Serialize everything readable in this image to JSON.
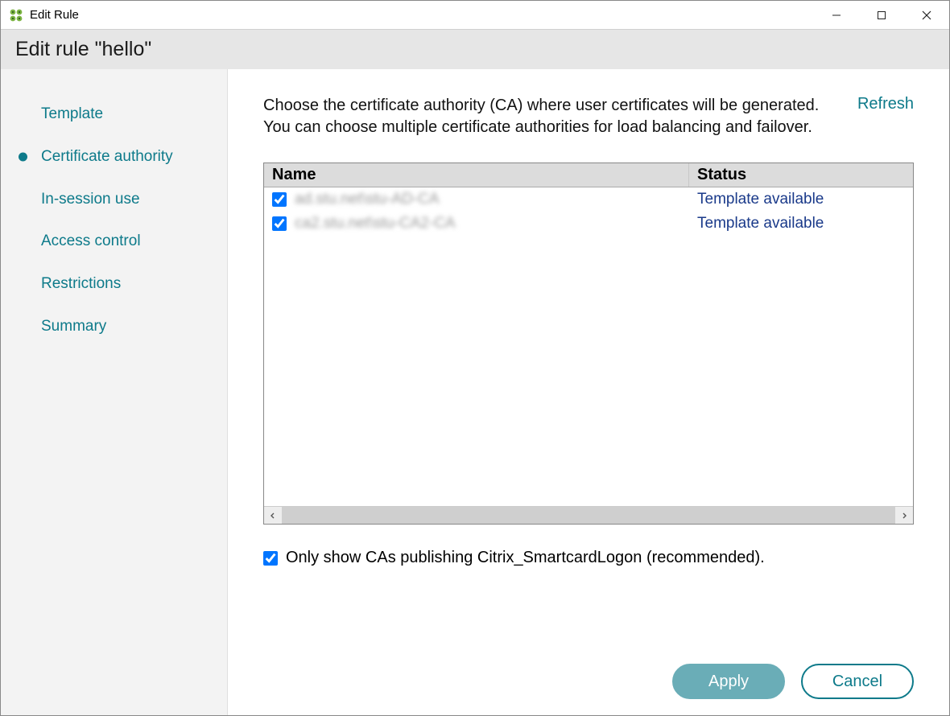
{
  "window": {
    "title": "Edit Rule"
  },
  "header": {
    "title": "Edit rule \"hello\""
  },
  "sidebar": {
    "items": [
      {
        "label": "Template",
        "active": false
      },
      {
        "label": "Certificate authority",
        "active": true
      },
      {
        "label": "In-session use",
        "active": false
      },
      {
        "label": "Access control",
        "active": false
      },
      {
        "label": "Restrictions",
        "active": false
      },
      {
        "label": "Summary",
        "active": false
      }
    ]
  },
  "content": {
    "description": "Choose the certificate authority (CA) where user certificates will be generated. You can choose multiple certificate authorities for load balancing and failover.",
    "refresh_label": "Refresh",
    "table": {
      "columns": {
        "name": "Name",
        "status": "Status"
      },
      "rows": [
        {
          "checked": true,
          "name": "ad.stu.net\\stu-AD-CA",
          "status": "Template available"
        },
        {
          "checked": true,
          "name": "ca2.stu.net\\stu-CA2-CA",
          "status": "Template available"
        }
      ]
    },
    "filter": {
      "checked": true,
      "label": "Only show CAs publishing Citrix_SmartcardLogon (recommended)."
    }
  },
  "footer": {
    "apply_label": "Apply",
    "cancel_label": "Cancel"
  }
}
